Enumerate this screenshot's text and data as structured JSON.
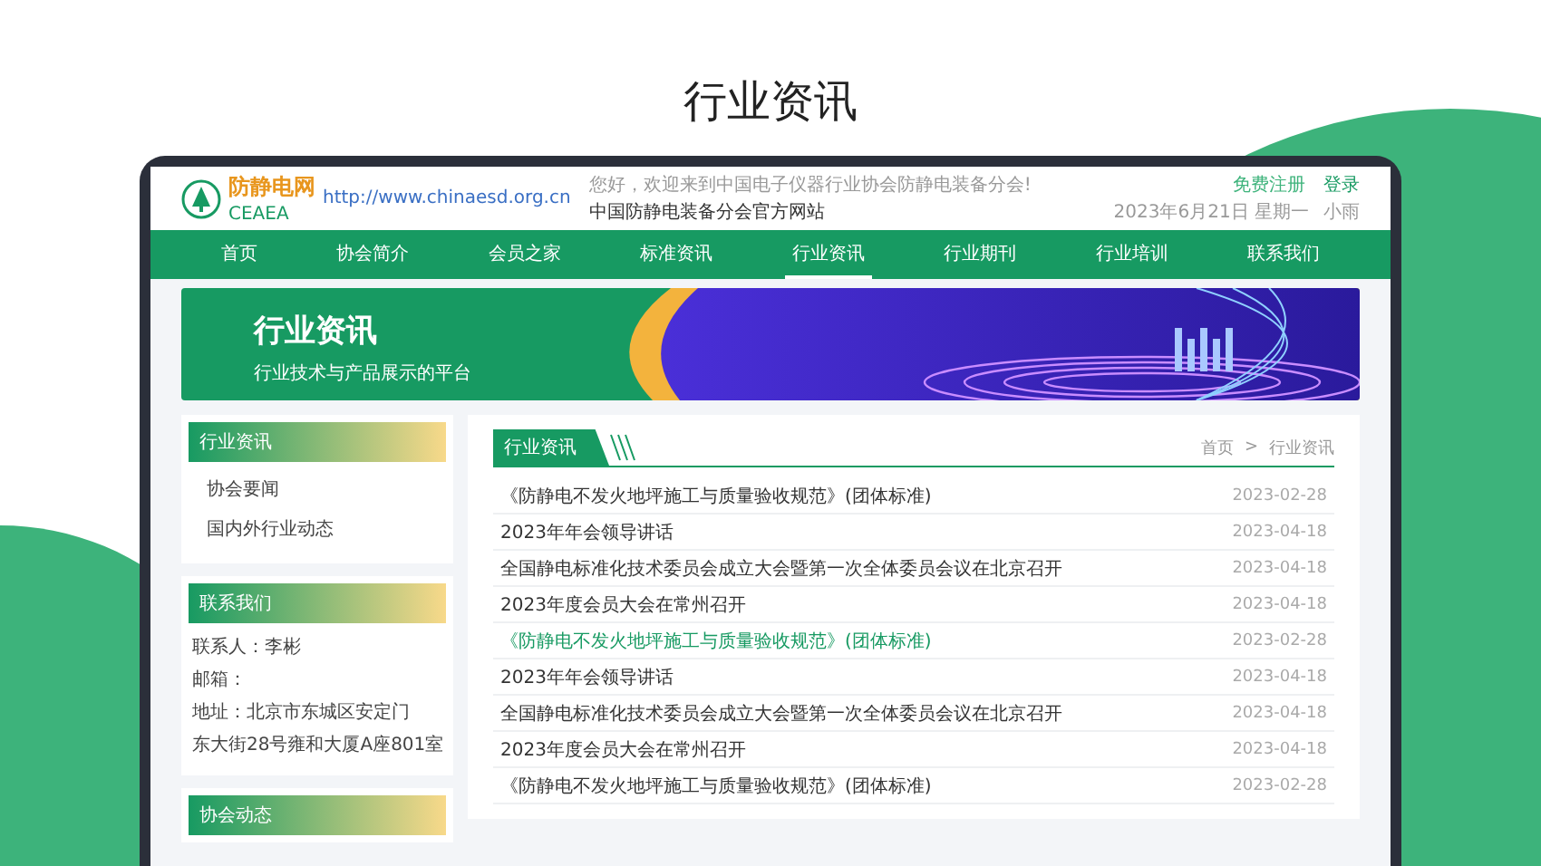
{
  "page_title": "行业资讯",
  "site": {
    "logo_text": "防静电网",
    "logo_abbr": "CEAEA",
    "logo_url": "http://www.chinaesd.org.cn",
    "welcome": "您好，欢迎来到中国电子仪器行业协会防静电装备分会!",
    "subtitle": "中国防静电装备分会官方网站",
    "register": "免费注册",
    "login": "登录",
    "date": "2023年6月21日 星期一",
    "weather": "小雨"
  },
  "nav": [
    {
      "label": "首页",
      "selected": false
    },
    {
      "label": "协会简介",
      "selected": false
    },
    {
      "label": "会员之家",
      "selected": false
    },
    {
      "label": "标准资讯",
      "selected": false
    },
    {
      "label": "行业资讯",
      "selected": true
    },
    {
      "label": "行业期刊",
      "selected": false
    },
    {
      "label": "行业培训",
      "selected": false
    },
    {
      "label": "联系我们",
      "selected": false
    }
  ],
  "banner": {
    "title": "行业资讯",
    "subtitle": "行业技术与产品展示的平台"
  },
  "sidebar": {
    "news": {
      "title": "行业资讯",
      "items": [
        "协会要闻",
        "国内外行业动态"
      ]
    },
    "contact": {
      "title": "联系我们",
      "lines": [
        "联系人：李彬",
        "邮箱：",
        "地址：北京市东城区安定门",
        "东大街28号雍和大厦A座801室"
      ]
    },
    "events": {
      "title": "协会动态"
    }
  },
  "list": {
    "title": "行业资讯",
    "breadcrumb": [
      "首页",
      ">",
      "行业资讯"
    ],
    "rows": [
      {
        "title": "《防静电不发火地坪施工与质量验收规范》(团体标准)",
        "date": "2023-02-28",
        "selected": false
      },
      {
        "title": "2023年年会领导讲话",
        "date": "2023-04-18",
        "selected": false
      },
      {
        "title": "全国静电标准化技术委员会成立大会暨第一次全体委员会议在北京召开",
        "date": "2023-04-18",
        "selected": false
      },
      {
        "title": "2023年度会员大会在常州召开",
        "date": "2023-04-18",
        "selected": false
      },
      {
        "title": "《防静电不发火地坪施工与质量验收规范》(团体标准)",
        "date": "2023-02-28",
        "selected": true
      },
      {
        "title": "2023年年会领导讲话",
        "date": "2023-04-18",
        "selected": false
      },
      {
        "title": "全国静电标准化技术委员会成立大会暨第一次全体委员会议在北京召开",
        "date": "2023-04-18",
        "selected": false
      },
      {
        "title": "2023年度会员大会在常州召开",
        "date": "2023-04-18",
        "selected": false
      },
      {
        "title": "《防静电不发火地坪施工与质量验收规范》(团体标准)",
        "date": "2023-02-28",
        "selected": false
      }
    ]
  }
}
